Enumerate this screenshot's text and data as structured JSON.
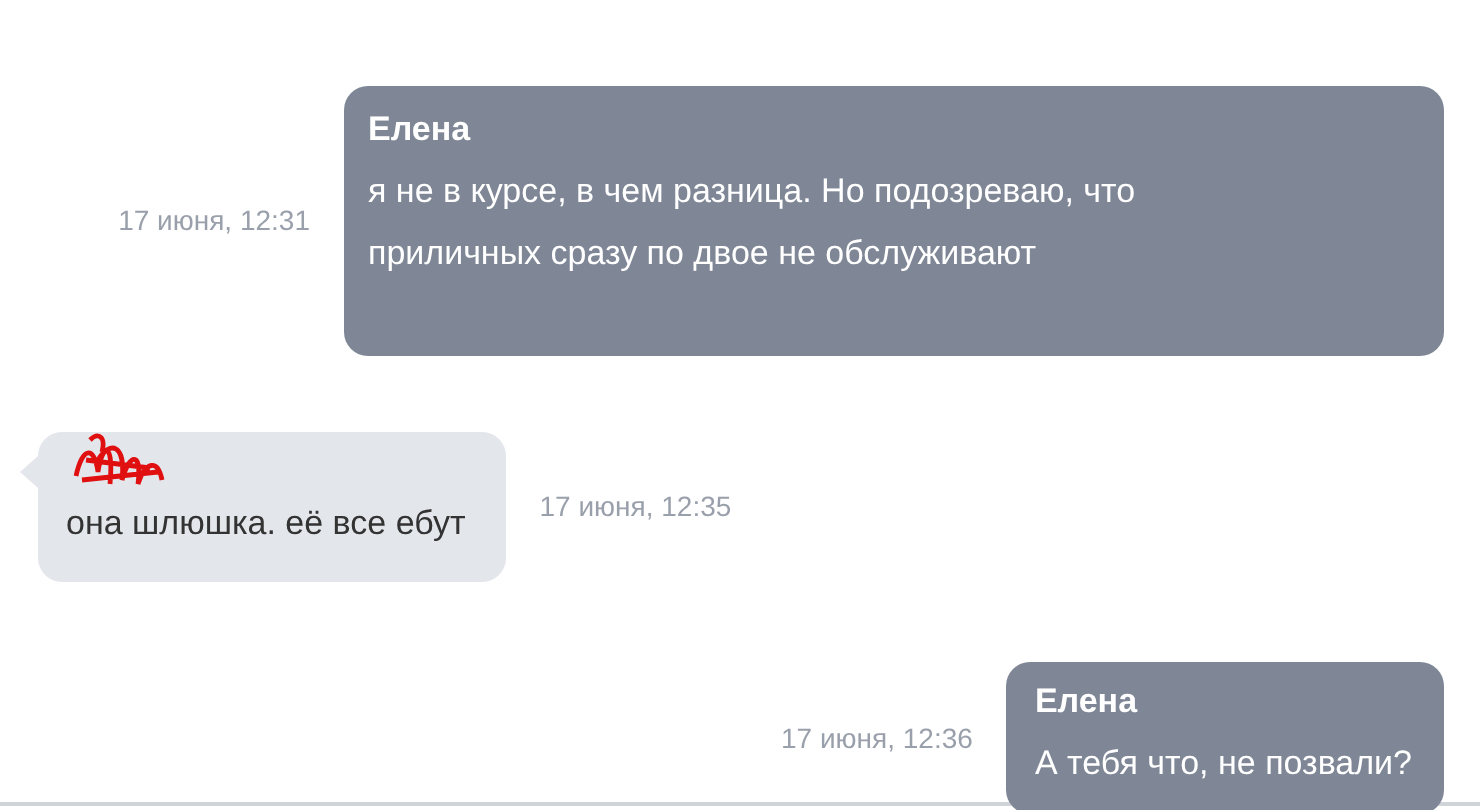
{
  "messages": [
    {
      "kind": "outgoing",
      "author": "Елена",
      "text": "я не в курсе, в чем разница. Но подозреваю, что приличных сразу по двое не обслуживают",
      "time": "17 июня, 12:31"
    },
    {
      "kind": "incoming",
      "redacted": true,
      "text": "она шлюшка. её все ебут",
      "time": "17 июня, 12:35"
    },
    {
      "kind": "outgoing",
      "author": "Елена",
      "text": "А тебя что, не позвали?",
      "time": "17 июня, 12:36"
    }
  ]
}
